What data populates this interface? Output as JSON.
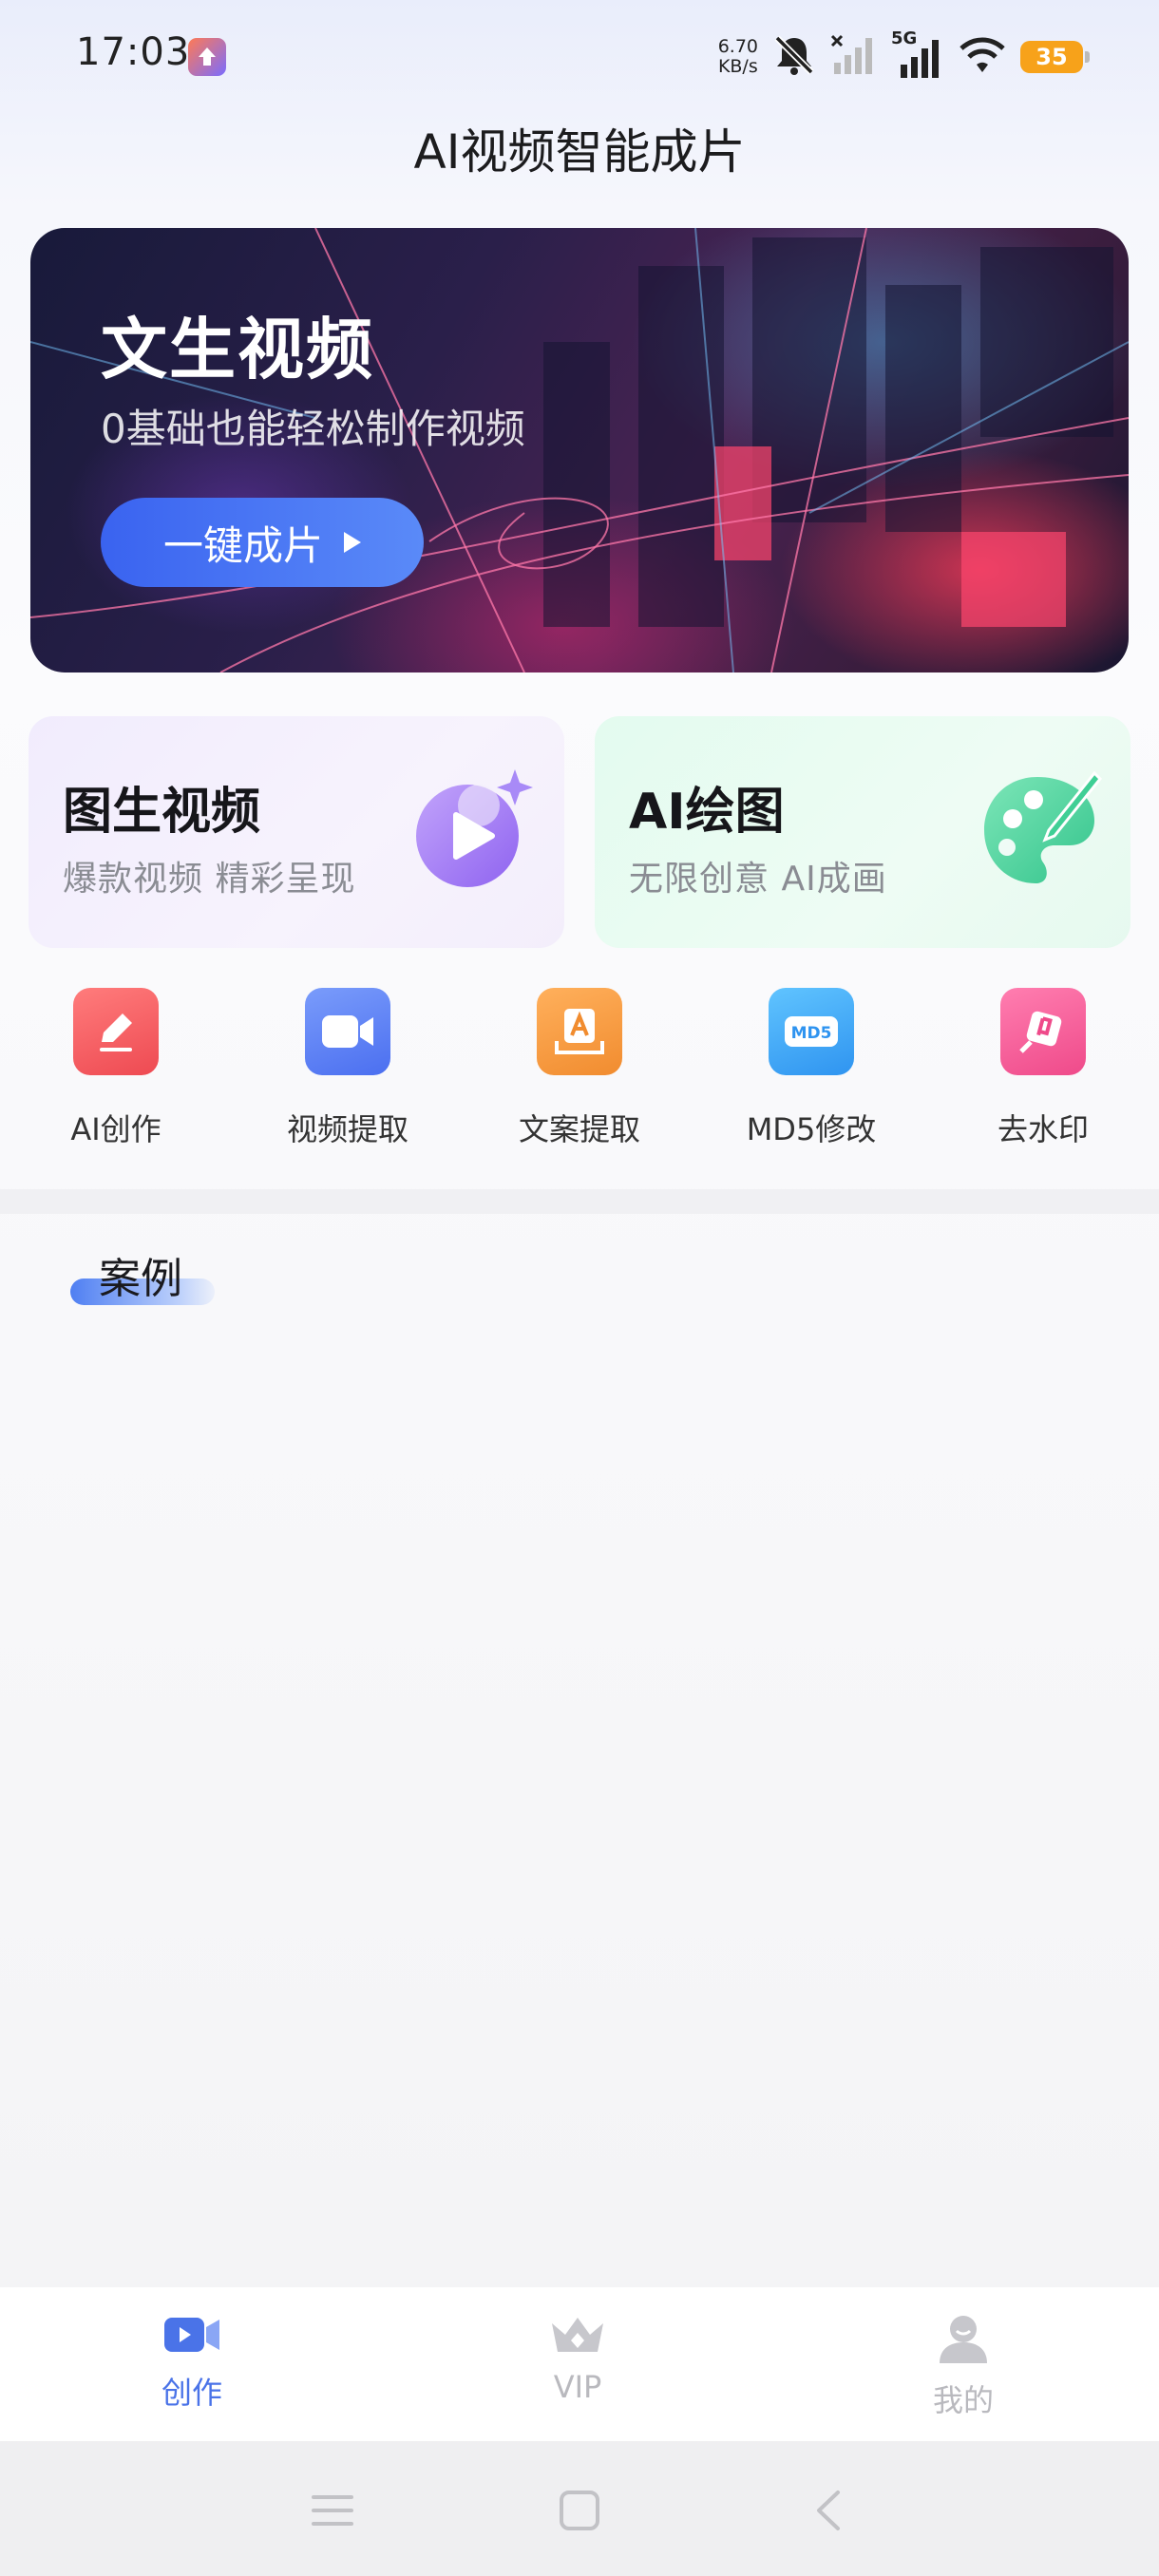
{
  "status_bar": {
    "time": "17:03",
    "net_speed_value": "6.70",
    "net_speed_unit": "KB/s",
    "signal_label": "5G",
    "battery": "35",
    "icons": [
      "notification-upload-icon",
      "mute-icon",
      "no-signal-icon",
      "signal-5g-icon",
      "wifi-icon",
      "battery-icon"
    ]
  },
  "header": {
    "title": "AI视频智能成片"
  },
  "banner": {
    "title": "文生视频",
    "subtitle": "0基础也能轻松制作视频",
    "button_label": "一键成片"
  },
  "feature_cards": [
    {
      "title": "图生视频",
      "subtitle": "爆款视频 精彩呈现",
      "icon": "video-play-icon"
    },
    {
      "title": "AI绘图",
      "subtitle": "无限创意 AI成画",
      "icon": "palette-icon"
    }
  ],
  "tools": [
    {
      "label": "AI创作",
      "icon": "pen-icon",
      "color": "#f2545b"
    },
    {
      "label": "视频提取",
      "icon": "video-camera-icon",
      "color": "#5a7ff5"
    },
    {
      "label": "文案提取",
      "icon": "text-extract-icon",
      "color": "#f59a3c"
    },
    {
      "label": "MD5修改",
      "icon": "md5-icon",
      "color": "#3aa8f5"
    },
    {
      "label": "去水印",
      "icon": "stamp-icon",
      "color": "#f2508f"
    }
  ],
  "section": {
    "title": "案例"
  },
  "tab_bar": {
    "tabs": [
      {
        "label": "创作",
        "icon": "video-camera-icon",
        "active": true
      },
      {
        "label": "VIP",
        "icon": "crown-icon",
        "active": false
      },
      {
        "label": "我的",
        "icon": "person-icon",
        "active": false
      }
    ],
    "active_color": "#4a73e8",
    "inactive_color": "#b9b9be"
  },
  "nav_bar": {
    "buttons": [
      "menu-icon",
      "home-icon",
      "back-icon"
    ]
  }
}
